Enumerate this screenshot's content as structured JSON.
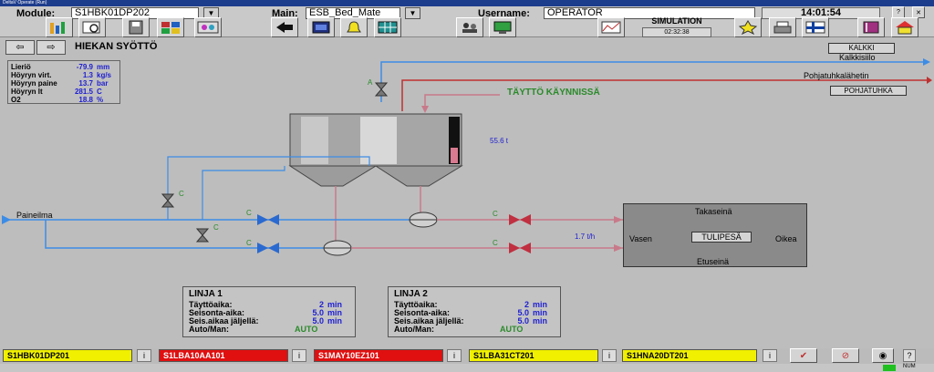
{
  "window": {
    "title": "DeltaV Operate (Run)"
  },
  "toolbar": {
    "module_label": "Module:",
    "module_value": "S1HBK01DP202",
    "main_label": "Main:",
    "main_value": "ESB_Bed_Mate",
    "username_label": "Username:",
    "username_value": "OPERATOR",
    "sim_label": "SIMULATION",
    "sim_time": "02:32:38",
    "clock": "14:01:54"
  },
  "page": {
    "title": "HIEKAN SYÖTTÖ"
  },
  "info": {
    "rows": [
      {
        "label": "Lieriö",
        "value": "-79.9",
        "unit": "mm"
      },
      {
        "label": "Höyryn virt.",
        "value": "1.3",
        "unit": "kg/s"
      },
      {
        "label": "Höyryn paine",
        "value": "13.7",
        "unit": "bar"
      },
      {
        "label": "Höyryn lt",
        "value": "281.5",
        "unit": "C"
      },
      {
        "label": "O2",
        "value": "18.8",
        "unit": "%"
      }
    ]
  },
  "process": {
    "kalkki_button": "KALKKI",
    "kalkkisiilo": "Kalkkisiilo",
    "pohjatuhka_label": "Pohjatuhkalähetin",
    "pohjatuhka_button": "POHJATUHKA",
    "status": "TÄYTTÖ KÄYNNISSÄ",
    "silo_level": "55.6 t",
    "paineilma": "Paineilma",
    "valve_a": "A",
    "c": "C",
    "flow": "1.7 t/h",
    "furnace": {
      "top": "Takaseinä",
      "left": "Vasen",
      "right": "Oikea",
      "bottom": "Etuseinä",
      "center_button": "TULIPESÄ"
    }
  },
  "lines": [
    {
      "title": "LINJA 1",
      "fill_label": "Täyttöaika:",
      "fill_value": "2",
      "fill_unit": "min",
      "stop_label": "Seisonta-aika:",
      "stop_value": "5.0",
      "stop_unit": "min",
      "remain_label": "Seis.aikaa jäljellä:",
      "remain_value": "5.0",
      "remain_unit": "min",
      "mode_label": "Auto/Man:",
      "mode_value": "AUTO"
    },
    {
      "title": "LINJA 2",
      "fill_label": "Täyttöaika:",
      "fill_value": "2",
      "fill_unit": "min",
      "stop_label": "Seisonta-aika:",
      "stop_value": "5.0",
      "stop_unit": "min",
      "remain_label": "Seis.aikaa jäljellä:",
      "remain_value": "5.0",
      "remain_unit": "min",
      "mode_label": "Auto/Man:",
      "mode_value": "AUTO"
    }
  ],
  "alarms": [
    {
      "tag": "S1HBK01DP201",
      "color": "#f0f000",
      "info": "i"
    },
    {
      "tag": "S1LBA10AA101",
      "color": "#e01010",
      "info": "i"
    },
    {
      "tag": "S1MAY10EZ101",
      "color": "#e01010",
      "info": "i"
    },
    {
      "tag": "S1LBA31CT201",
      "color": "#f0f000",
      "info": "i"
    },
    {
      "tag": "S1HNA20DT201",
      "color": "#f0f000",
      "info": "i"
    }
  ],
  "statusbar": {
    "help": "?",
    "num": "NUM"
  },
  "colors": {
    "blue_line": "#3c8ce6",
    "red_line": "#c03030",
    "pink_line": "#c87a8a",
    "valve_blue": "#2a6ad0",
    "valve_red": "#c03040",
    "accent_green": "#2a8a2a"
  }
}
